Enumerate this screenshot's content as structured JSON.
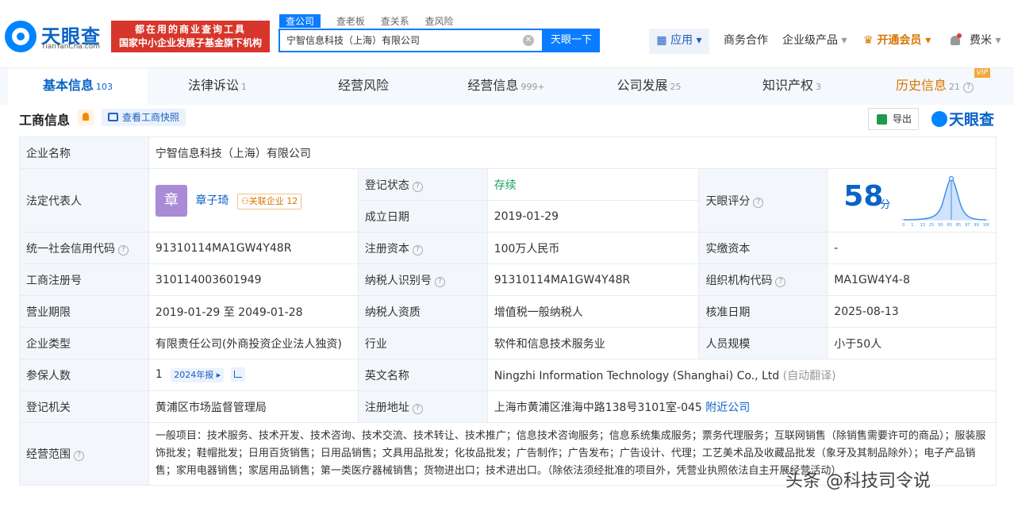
{
  "header": {
    "logo_text": "天眼查",
    "logo_sub": "TianYanCha.com",
    "banner_line1": "都在用的商业查询工具",
    "banner_line2": "国家中小企业发展子基金旗下机构",
    "search_tabs": [
      "查公司",
      "查老板",
      "查关系",
      "查风险"
    ],
    "search_value": "宁智信息科技（上海）有限公司",
    "search_button": "天眼一下",
    "nav": {
      "apps": "应用",
      "business": "商务合作",
      "enterprise": "企业级产品",
      "vip": "开通会员",
      "user": "费米"
    }
  },
  "tabs": [
    {
      "label": "基本信息",
      "count": "103"
    },
    {
      "label": "法律诉讼",
      "count": "1"
    },
    {
      "label": "经营风险",
      "count": ""
    },
    {
      "label": "经营信息",
      "count": "999+"
    },
    {
      "label": "公司发展",
      "count": "25"
    },
    {
      "label": "知识产权",
      "count": "3"
    },
    {
      "label": "历史信息",
      "count": "21"
    }
  ],
  "vip_badge": "VIP",
  "section": {
    "title": "工商信息",
    "snapshot_button": "查看工商快照",
    "export_button": "导出",
    "watermark_logo": "天眼查"
  },
  "company": {
    "name_label": "企业名称",
    "name": "宁智信息科技（上海）有限公司",
    "legal_label": "法定代表人",
    "avatar_char": "章",
    "legal_name": "章子琦",
    "related_label": "关联企业",
    "related_count": "12",
    "status_label": "登记状态",
    "status": "存续",
    "founded_label": "成立日期",
    "founded": "2019-01-29",
    "score_label": "天眼评分",
    "score": "58",
    "score_unit": "分",
    "score_axis": [
      "0",
      "1",
      "13",
      "25",
      "50",
      "65",
      "85",
      "97",
      "99",
      "100"
    ],
    "credit_label": "统一社会信用代码",
    "credit": "91310114MA1GW4Y48R",
    "capital_label": "注册资本",
    "capital": "100万人民币",
    "paid_label": "实缴资本",
    "paid": "-",
    "reg_no_label": "工商注册号",
    "reg_no": "310114003601949",
    "tax_label": "纳税人识别号",
    "tax": "91310114MA1GW4Y48R",
    "org_label": "组织机构代码",
    "org": "MA1GW4Y4-8",
    "term_label": "营业期限",
    "term": "2019-01-29 至 2049-01-28",
    "taxpayer_label": "纳税人资质",
    "taxpayer": "增值税一般纳税人",
    "approve_label": "核准日期",
    "approve": "2025-08-13",
    "type_label": "企业类型",
    "type": "有限责任公司(外商投资企业法人独资)",
    "industry_label": "行业",
    "industry": "软件和信息技术服务业",
    "staff_label": "人员规模",
    "staff": "小于50人",
    "insured_label": "参保人数",
    "insured": "1",
    "report_tag": "2024年报",
    "english_label": "英文名称",
    "english": "Ningzhi Information Technology (Shanghai) Co., Ltd",
    "auto_translate": "(自动翻译)",
    "authority_label": "登记机关",
    "authority": "黄浦区市场监督管理局",
    "address_label": "注册地址",
    "address": "上海市黄浦区淮海中路138号3101室-045",
    "nearby": "附近公司",
    "scope_label": "经营范围",
    "scope": "一般项目：技术服务、技术开发、技术咨询、技术交流、技术转让、技术推广；信息技术咨询服务；信息系统集成服务；票务代理服务；互联网销售（除销售需要许可的商品）；服装服饰批发；鞋帽批发；日用百货销售；日用品销售；文具用品批发；化妆品批发；广告制作；广告发布；广告设计、代理；工艺美术品及收藏品批发（象牙及其制品除外）；电子产品销售；家用电器销售；家居用品销售；第一类医疗器械销售；货物进出口；技术进出口。（除依法须经批准的项目外，凭营业执照依法自主开展经营活动）"
  },
  "watermark": "头条 @科技司令说"
}
